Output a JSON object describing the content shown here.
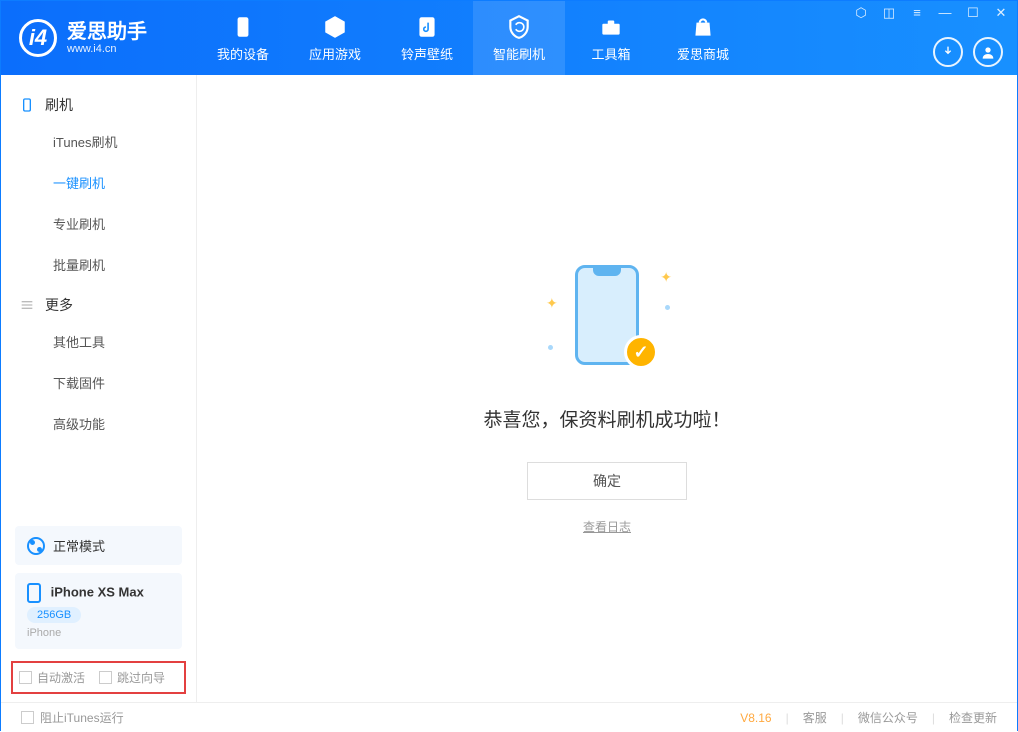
{
  "app": {
    "name": "爱思助手",
    "url": "www.i4.cn"
  },
  "tabs": [
    {
      "label": "我的设备"
    },
    {
      "label": "应用游戏"
    },
    {
      "label": "铃声壁纸"
    },
    {
      "label": "智能刷机"
    },
    {
      "label": "工具箱"
    },
    {
      "label": "爱思商城"
    }
  ],
  "sidebar": {
    "section1": {
      "title": "刷机"
    },
    "items1": [
      {
        "label": "iTunes刷机"
      },
      {
        "label": "一键刷机"
      },
      {
        "label": "专业刷机"
      },
      {
        "label": "批量刷机"
      }
    ],
    "section2": {
      "title": "更多"
    },
    "items2": [
      {
        "label": "其他工具"
      },
      {
        "label": "下载固件"
      },
      {
        "label": "高级功能"
      }
    ]
  },
  "device": {
    "mode": "正常模式",
    "name": "iPhone XS Max",
    "capacity": "256GB",
    "type": "iPhone"
  },
  "checkboxes": {
    "auto_activate": "自动激活",
    "skip_guide": "跳过向导"
  },
  "main": {
    "success_text": "恭喜您，保资料刷机成功啦！",
    "ok_button": "确定",
    "view_log": "查看日志"
  },
  "footer": {
    "block_itunes": "阻止iTunes运行",
    "version": "V8.16",
    "links": [
      "客服",
      "微信公众号",
      "检查更新"
    ]
  }
}
